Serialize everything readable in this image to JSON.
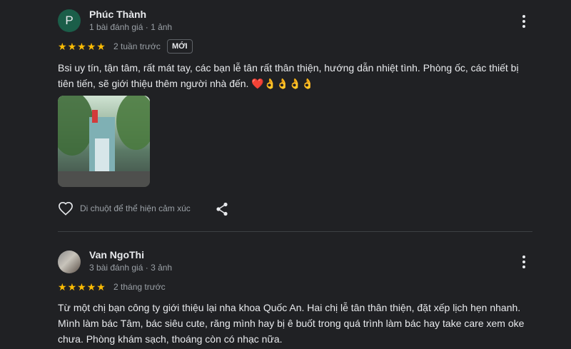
{
  "reviews": [
    {
      "author": "Phúc Thành",
      "avatar_letter": "P",
      "meta": "1 bài đánh giá · 1 ảnh",
      "rating": 5,
      "stars": "★★★★★",
      "time": "2 tuần trước",
      "badge": "MỚI",
      "text": "Bsi uy tín, tận tâm, rất mát tay, các bạn lễ tân rất thân thiện, hướng dẫn nhiệt tình. Phòng ốc, các thiết bị tiên tiến, sẽ giới thiệu thêm người nhà đến. ❤️👌👌👌👌",
      "photo_count": 1,
      "like_label": "Di chuột để thể hiện cảm xúc"
    },
    {
      "author": "Van NgoThi",
      "meta": "3 bài đánh giá · 3 ảnh",
      "rating": 5,
      "stars": "★★★★★",
      "time": "2 tháng trước",
      "text": "Từ một chị bạn công ty giới thiệu lại nha khoa Quốc An. Hai chị lễ tân thân thiện, đặt xếp lịch hẹn nhanh. Mình làm bác Tâm, bác siêu cute, răng mình hay bị ê buốt trong quá trình làm bác hay take care xem oke chưa. Phòng khám sạch, thoáng còn có nhạc nữa."
    }
  ],
  "icons": {
    "more": "more-vert-icon",
    "star": "star-icon",
    "like": "heart-outline-icon",
    "share": "share-icon"
  },
  "colors": {
    "background": "#202124",
    "star": "#fbbc04",
    "text": "#e8eaed",
    "secondary_text": "#9aa0a6",
    "avatar_p": "#1b5e49"
  }
}
